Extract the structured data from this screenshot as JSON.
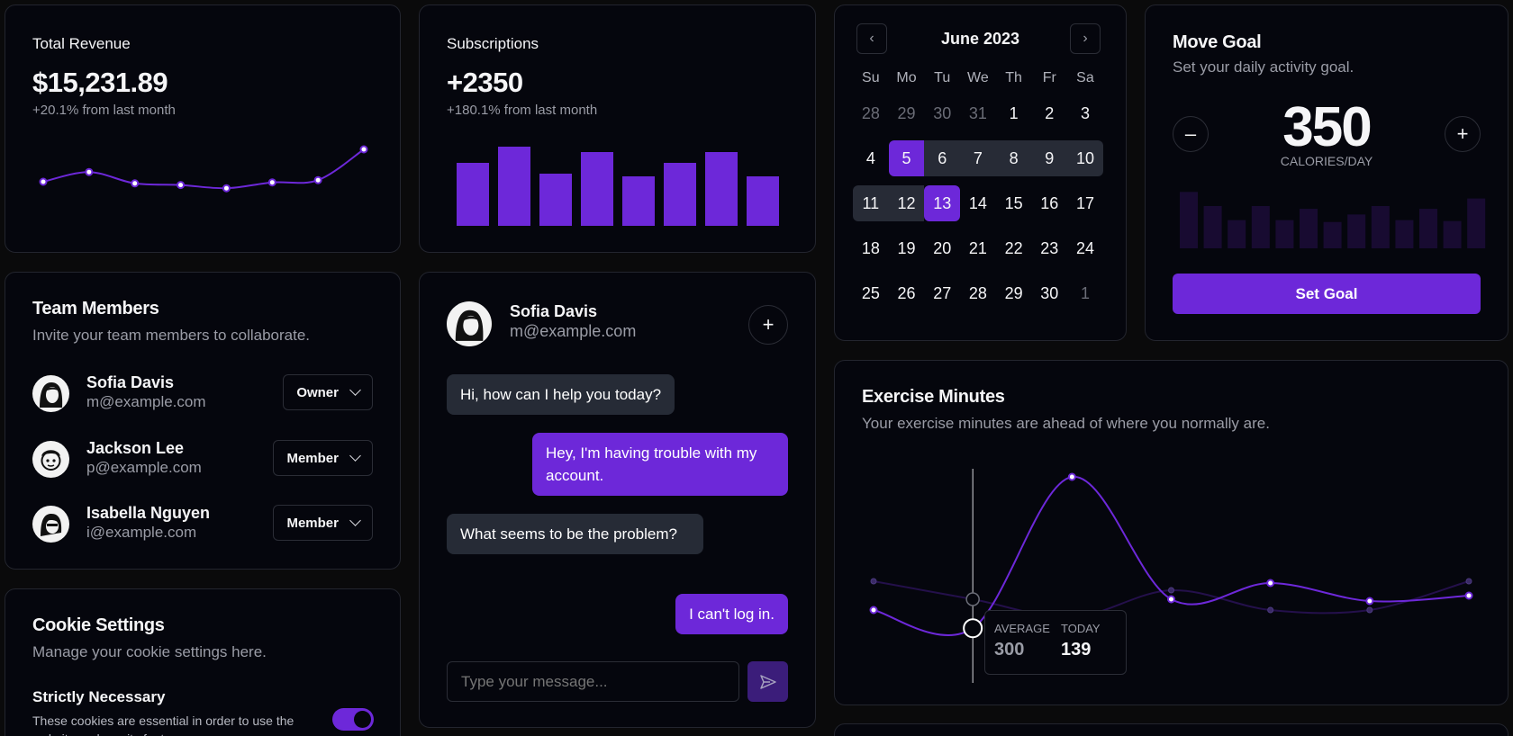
{
  "revenue": {
    "label": "Total Revenue",
    "value": "$15,231.89",
    "change": "+20.1% from last month",
    "chart": [
      10,
      13,
      9.5,
      9,
      8,
      9.8,
      10.5,
      20
    ]
  },
  "subscriptions": {
    "label": "Subscriptions",
    "value": "+2350",
    "change": "+180.1% from last month",
    "bars": [
      70,
      88,
      58,
      82,
      55,
      70,
      82,
      55
    ]
  },
  "calendar": {
    "month": "June 2023",
    "weekdays": [
      "Su",
      "Mo",
      "Tu",
      "We",
      "Th",
      "Fr",
      "Sa"
    ],
    "weeks": [
      [
        "28",
        "29",
        "30",
        "31",
        "1",
        "2",
        "3"
      ],
      [
        "4",
        "5",
        "6",
        "7",
        "8",
        "9",
        "10"
      ],
      [
        "11",
        "12",
        "13",
        "14",
        "15",
        "16",
        "17"
      ],
      [
        "18",
        "19",
        "20",
        "21",
        "22",
        "23",
        "24"
      ],
      [
        "25",
        "26",
        "27",
        "28",
        "29",
        "30",
        "1"
      ]
    ],
    "selected_start": "5",
    "selected_end": "13"
  },
  "move_goal": {
    "title": "Move Goal",
    "subtitle": "Set your daily activity goal.",
    "value": "350",
    "unit": "CALORIES/DAY",
    "bars": [
      60,
      45,
      30,
      45,
      30,
      42,
      28,
      36,
      45,
      30,
      42,
      29,
      53
    ],
    "button": "Set Goal",
    "minus": "–",
    "plus": "+"
  },
  "team": {
    "title": "Team Members",
    "subtitle": "Invite your team members to collaborate.",
    "members": [
      {
        "name": "Sofia Davis",
        "email": "m@example.com",
        "role": "Owner"
      },
      {
        "name": "Jackson Lee",
        "email": "p@example.com",
        "role": "Member"
      },
      {
        "name": "Isabella Nguyen",
        "email": "i@example.com",
        "role": "Member"
      }
    ]
  },
  "chat": {
    "contact_name": "Sofia Davis",
    "contact_email": "m@example.com",
    "messages": [
      {
        "from": "agent",
        "text": "Hi, how can I help you today?"
      },
      {
        "from": "user",
        "text": "Hey, I'm having trouble with my account."
      },
      {
        "from": "agent",
        "text": "What seems to be the problem?"
      },
      {
        "from": "user",
        "text": "I can't log in."
      }
    ],
    "input_placeholder": "Type your message..."
  },
  "exercise": {
    "title": "Exercise Minutes",
    "subtitle": "Your exercise minutes are ahead of where you normally are.",
    "today": [
      240,
      139,
      980,
      300,
      390,
      290,
      320
    ],
    "average": [
      400,
      300,
      200,
      350,
      240,
      240,
      400
    ],
    "tooltip": {
      "average_label": "AVERAGE",
      "today_label": "TODAY",
      "average_value": "300",
      "today_value": "139"
    }
  },
  "cookies": {
    "title": "Cookie Settings",
    "subtitle": "Manage your cookie settings here.",
    "item_title": "Strictly Necessary",
    "item_desc": "These cookies are essential in order to use the website and use its features.",
    "enabled": true
  },
  "colors": {
    "accent": "#6d28d9",
    "accent_light": "#7c3aed",
    "bg": "#05060d"
  }
}
